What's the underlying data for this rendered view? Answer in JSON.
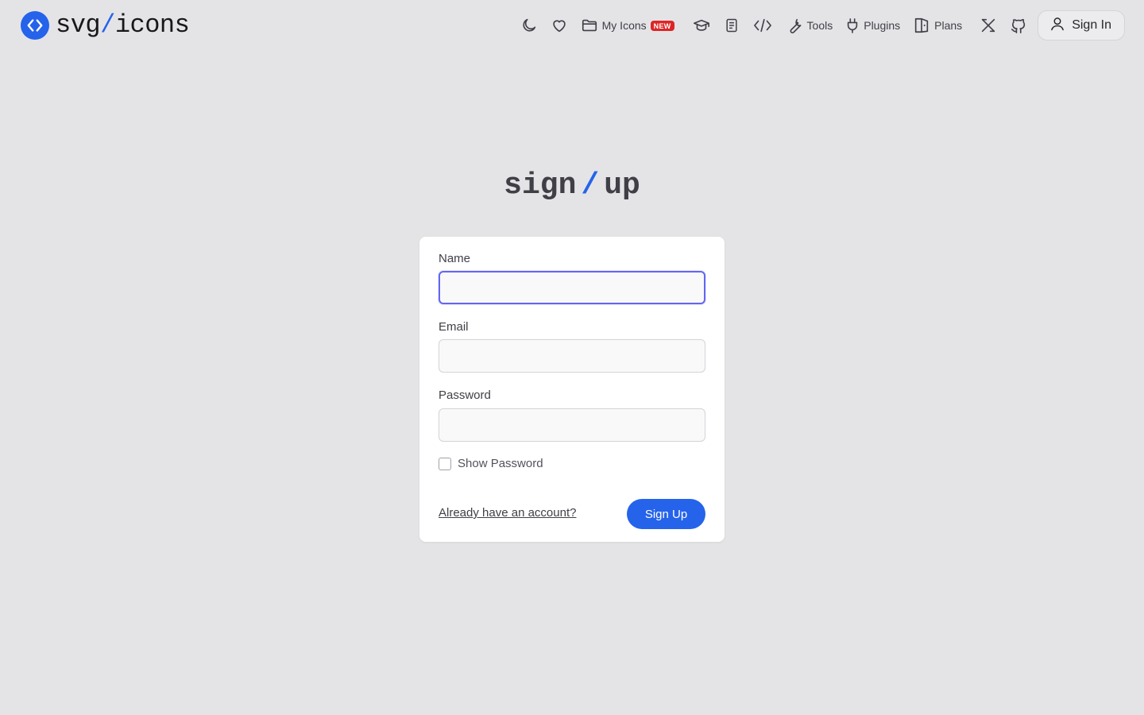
{
  "brand": {
    "name_left": "svg",
    "name_slash": "/",
    "name_right": "icons",
    "accent_color": "#2563eb"
  },
  "nav": {
    "theme_icon": "moon-icon",
    "favorites_icon": "heart-icon",
    "my_icons_label": "My Icons",
    "my_icons_badge": "NEW",
    "learn_icon": "graduation-cap-icon",
    "docs_icon": "document-icon",
    "code_icon": "code-icon",
    "tools_label": "Tools",
    "plugins_label": "Plugins",
    "plans_label": "Plans",
    "x_icon": "x-logo-icon",
    "github_icon": "github-icon",
    "sign_in_label": "Sign In"
  },
  "page": {
    "title_left": "sign",
    "title_slash": "/",
    "title_right": "up"
  },
  "form": {
    "name_label": "Name",
    "name_value": "",
    "email_label": "Email",
    "email_value": "",
    "password_label": "Password",
    "password_value": "",
    "show_password_label": "Show Password",
    "show_password_checked": false,
    "already_account_link": "Already have an account?",
    "submit_label": "Sign Up"
  },
  "colors": {
    "background": "#e4e4e7",
    "primary": "#2563eb",
    "focus_ring": "#6366f1",
    "badge": "#dc2626"
  }
}
